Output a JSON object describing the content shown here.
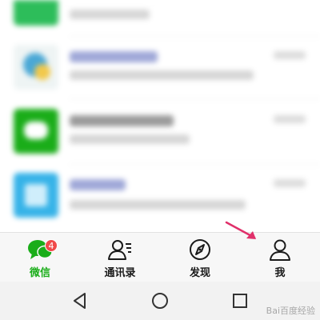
{
  "tabbar": {
    "tabs": [
      {
        "label": "微信",
        "icon": "chat-bubbles-icon",
        "active": true,
        "badge": "4"
      },
      {
        "label": "通讯录",
        "icon": "contacts-icon",
        "active": false
      },
      {
        "label": "发现",
        "icon": "compass-icon",
        "active": false
      },
      {
        "label": "我",
        "icon": "person-icon",
        "active": false
      }
    ]
  },
  "system_nav": {
    "buttons": [
      "back-icon",
      "home-icon",
      "recents-icon"
    ]
  },
  "colors": {
    "accent": "#1aad19",
    "badge": "#f04a4a",
    "annotation_arrow": "#e0306a"
  },
  "watermark": "Bai百度经验"
}
